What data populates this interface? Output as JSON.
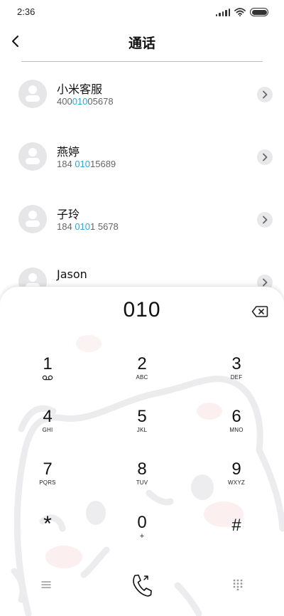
{
  "status_bar": {
    "time": "2:36"
  },
  "header": {
    "title": "通话"
  },
  "contacts": [
    {
      "name": "小米客服",
      "number_pre": "400",
      "number_hl": "010",
      "number_post": "05678"
    },
    {
      "name": "燕婷",
      "number_pre": "184 ",
      "number_hl": "010",
      "number_post": "15689"
    },
    {
      "name": "子玲",
      "number_pre": "184 ",
      "number_hl": "010",
      "number_post": "1 5678"
    },
    {
      "name": "Jason",
      "number_pre": "",
      "number_hl": "",
      "number_post": ""
    }
  ],
  "dialpad": {
    "input": "010",
    "keys": [
      {
        "digit": "1",
        "letters": ""
      },
      {
        "digit": "2",
        "letters": "ABC"
      },
      {
        "digit": "3",
        "letters": "DEF"
      },
      {
        "digit": "4",
        "letters": "GHI"
      },
      {
        "digit": "5",
        "letters": "JKL"
      },
      {
        "digit": "6",
        "letters": "MNO"
      },
      {
        "digit": "7",
        "letters": "PQRS"
      },
      {
        "digit": "8",
        "letters": "TUV"
      },
      {
        "digit": "9",
        "letters": "WXYZ"
      },
      {
        "digit": "*",
        "letters": ""
      },
      {
        "digit": "0",
        "letters": "+"
      },
      {
        "digit": "#",
        "letters": ""
      }
    ]
  },
  "colors": {
    "highlight": "#2ea8d6",
    "avatar_bg": "#e6e6e8"
  },
  "icons": {
    "back": "chevron-left-icon",
    "row_action": "chevron-right-icon",
    "backspace": "backspace-icon",
    "voicemail": "voicemail-icon",
    "menu": "menu-icon",
    "call": "phone-icon",
    "dialpad_toggle": "dialpad-grid-icon"
  }
}
